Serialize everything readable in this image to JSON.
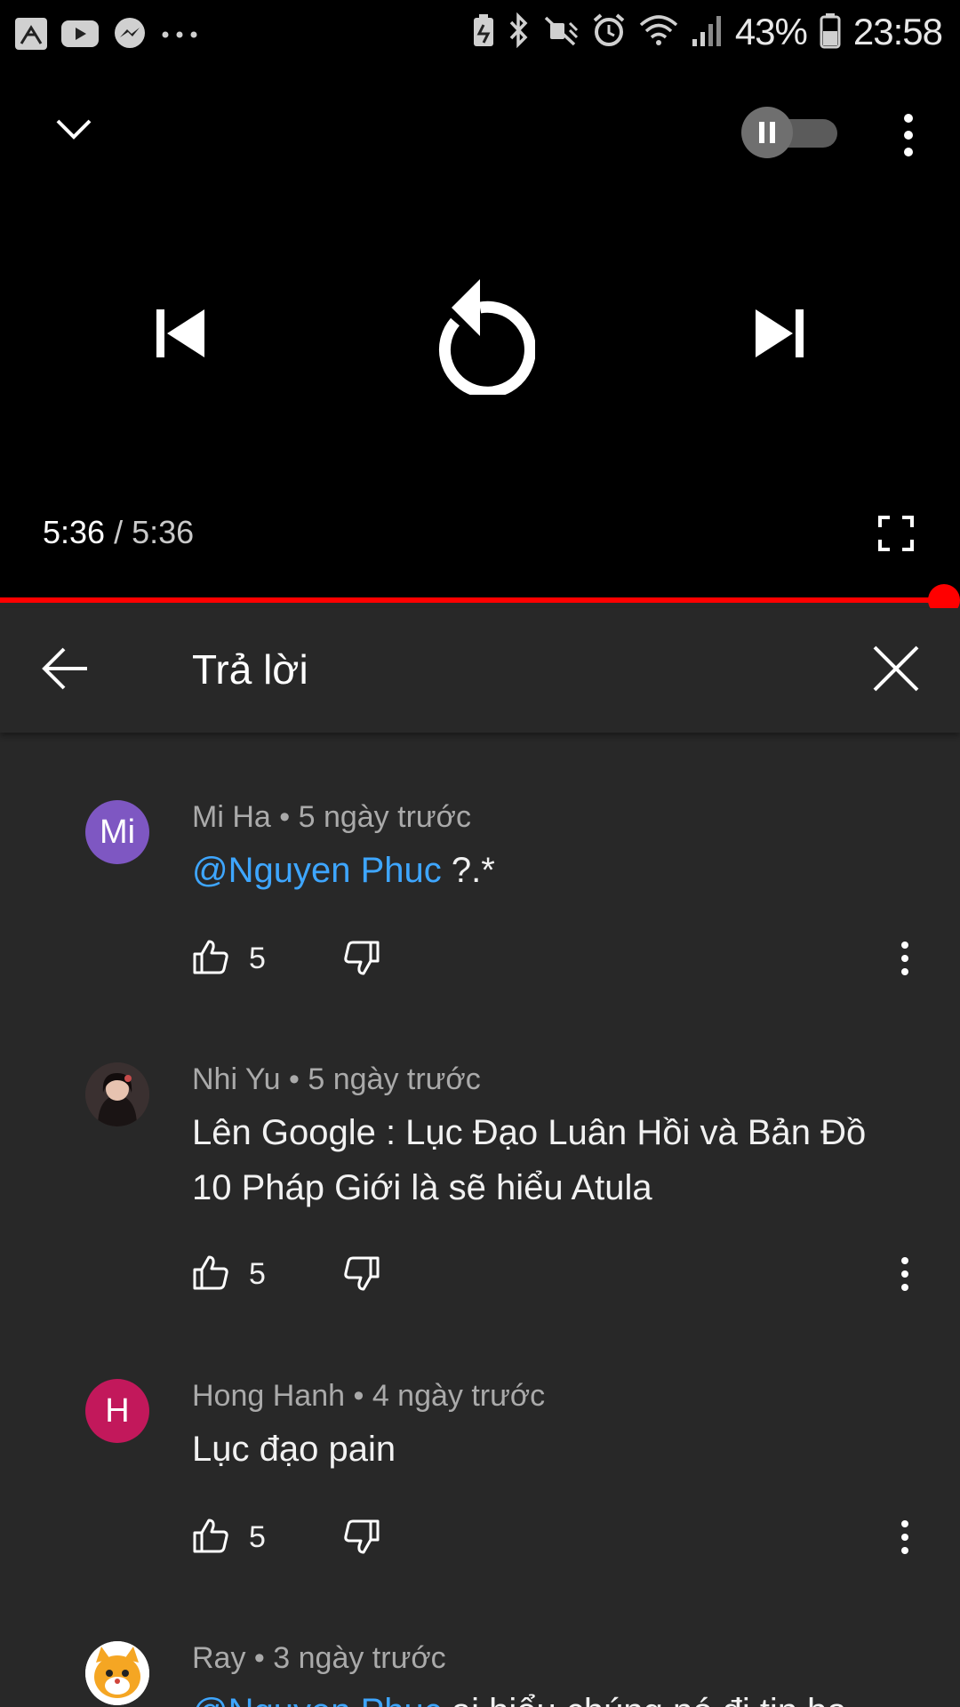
{
  "status_bar": {
    "battery_percent": "43%",
    "time": "23:58",
    "left_icons": [
      "app-icon",
      "youtube-icon",
      "messenger-icon",
      "more-notifications-icon"
    ],
    "right_icons": [
      "battery-saver-icon",
      "bluetooth-icon",
      "mute-icon",
      "alarm-icon",
      "wifi-icon",
      "signal-icon",
      "battery-icon"
    ]
  },
  "player": {
    "current_time": "5:36",
    "separator": " / ",
    "total_time": "5:36",
    "progress": 1.0,
    "accent_color": "#ff0000",
    "autoplay_toggle": "paused"
  },
  "replies_header": {
    "title": "Trả lời"
  },
  "comments": [
    {
      "author": "Mi Ha",
      "time": "5 ngày trước",
      "avatar_text": "Mi",
      "avatar_color": "#7e57c2",
      "mention": "@Nguyen Phuc",
      "text": " ?.*",
      "likes": "5"
    },
    {
      "author": "Nhi Yu",
      "time": "5 ngày trước",
      "avatar_text": "",
      "avatar_color": "#3a3030",
      "mention": "",
      "text": "Lên Google : Lục Đạo Luân Hồi và Bản Đồ 10 Pháp Giới là sẽ hiểu Atula",
      "likes": "5"
    },
    {
      "author": "Hong Hanh",
      "time": "4 ngày trước",
      "avatar_text": "H",
      "avatar_color": "#c2185b",
      "mention": "",
      "text": "Lục đạo pain",
      "likes": "5"
    },
    {
      "author": "Ray",
      "time": "3 ngày trước",
      "avatar_text": "",
      "avatar_color": "#f5a623",
      "mention": "@Nguyen Phuc",
      "text": " ai hiểu chúng nó đi tin ba"
    }
  ],
  "meta_separator": " • "
}
